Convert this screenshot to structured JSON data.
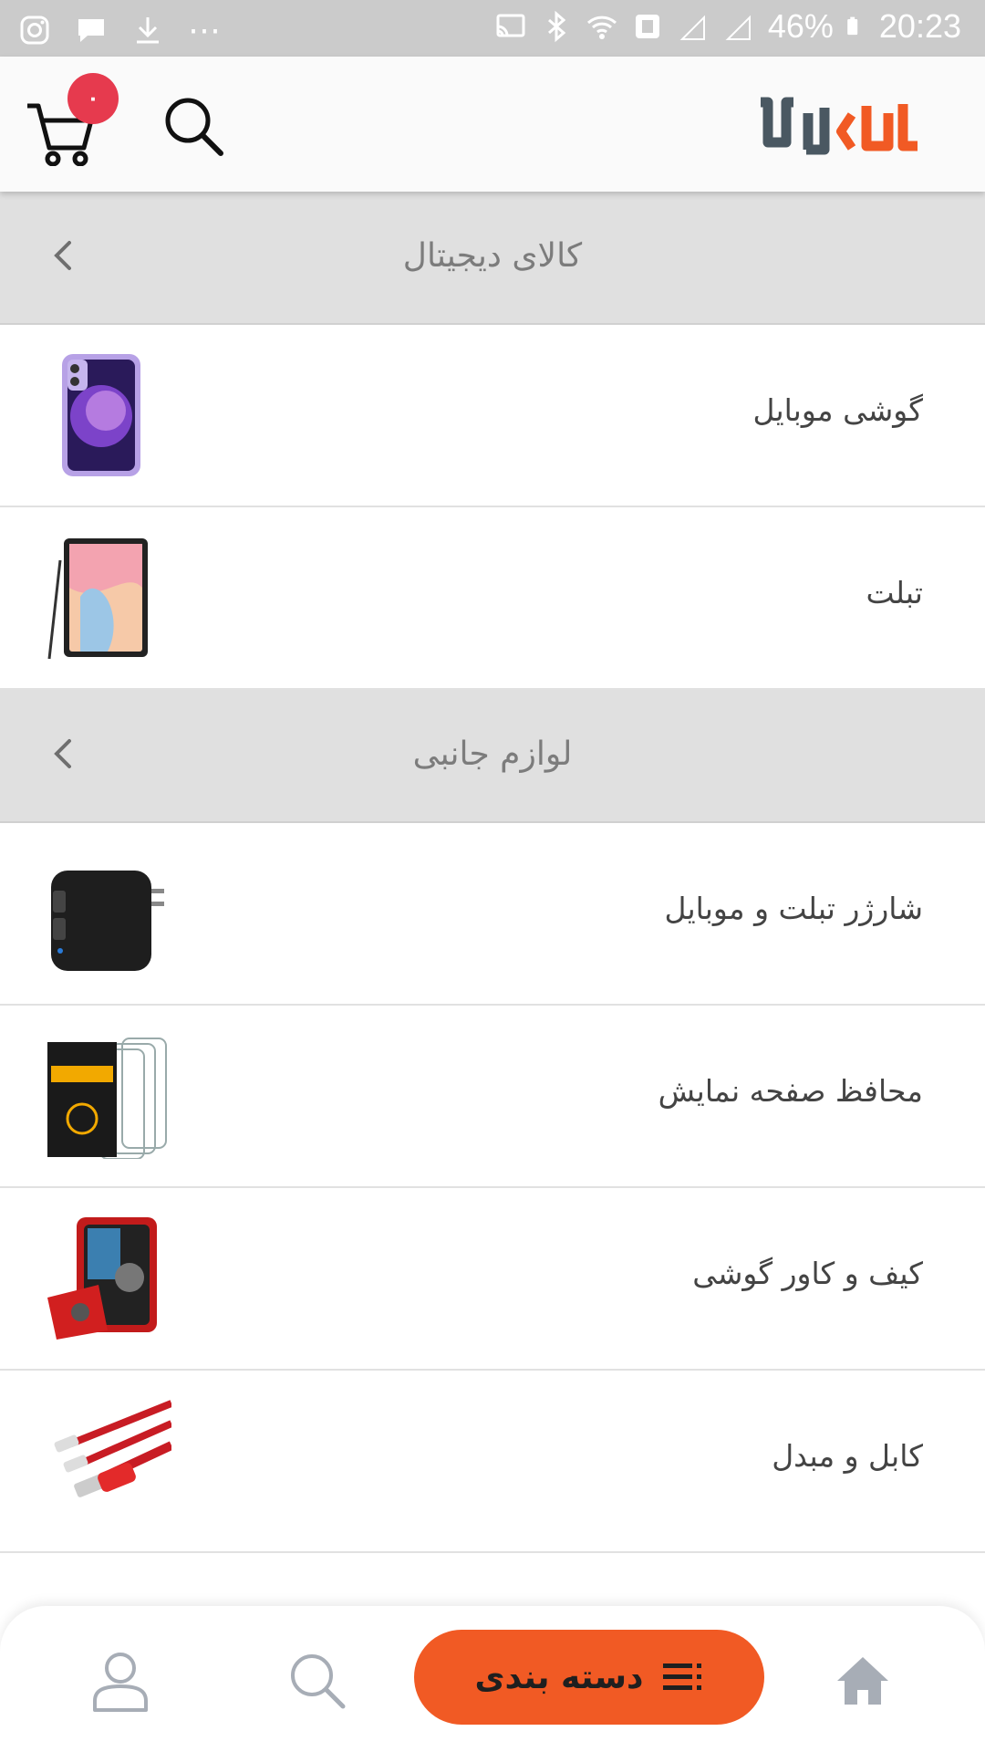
{
  "status_bar": {
    "battery": "46%",
    "time": "20:23",
    "dots": "⋯"
  },
  "header": {
    "cart_count": "۰",
    "logo_text": "لاکالا"
  },
  "sections": [
    {
      "title": "کالای دیجیتال",
      "items": [
        {
          "label": "گوشی موبایل",
          "image": "purple-phone"
        },
        {
          "label": "تبلت",
          "image": "tablet"
        }
      ]
    },
    {
      "title": "لوازم جانبی",
      "items": [
        {
          "label": "شارژر تبلت و موبایل",
          "image": "charger"
        },
        {
          "label": "محافظ صفحه نمایش",
          "image": "screen-protector"
        },
        {
          "label": "کیف و کاور گوشی",
          "image": "phone-case"
        },
        {
          "label": "کابل و مبدل",
          "image": "cable"
        }
      ]
    }
  ],
  "bottom_nav": {
    "category_label": "دسته بندی"
  },
  "colors": {
    "accent": "#f15a24",
    "badge": "#e63a4e",
    "logo_dark": "#4a5862",
    "section_bg": "#e0e0e0"
  }
}
